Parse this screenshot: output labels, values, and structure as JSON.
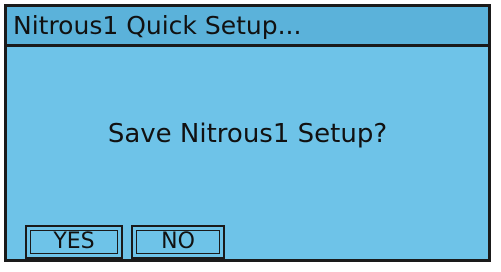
{
  "dialog": {
    "title": "Nitrous1 Quick Setup...",
    "message": "Save Nitrous1 Setup?",
    "buttons": {
      "yes_label": "YES",
      "no_label": "NO"
    }
  },
  "colors": {
    "background": "#6ec3e8",
    "title_bar": "#5bb2da",
    "border": "#1a1a1a",
    "text": "#111111"
  }
}
